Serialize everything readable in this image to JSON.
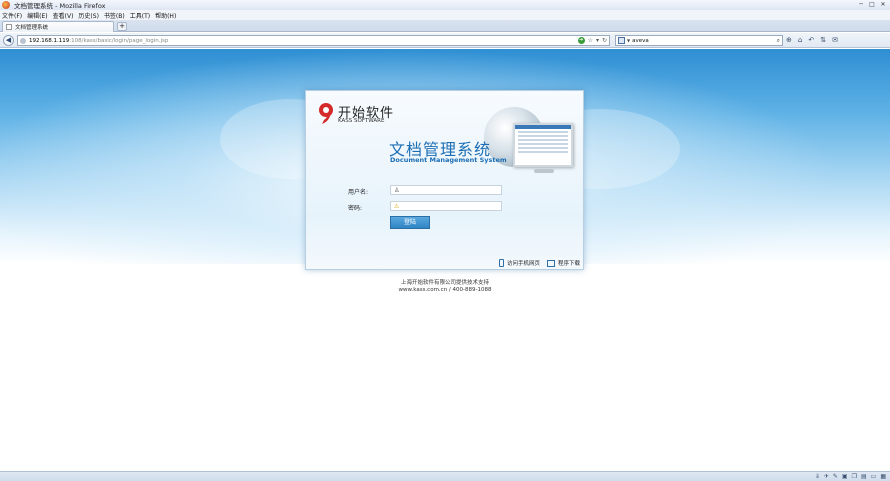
{
  "window": {
    "title": "文档管理系统 - Mozilla Firefox"
  },
  "menu": [
    "文件(F)",
    "编辑(E)",
    "查看(V)",
    "历史(S)",
    "书签(B)",
    "工具(T)",
    "帮助(H)"
  ],
  "tab": {
    "label": "文档管理系统"
  },
  "address": {
    "host": "192.168.1.119",
    "rest": ":108/kass/basic/login/page_login.jsp"
  },
  "search": {
    "value": "aveva"
  },
  "brand": {
    "cn": "开始软件",
    "en": "KASS SOFTWARE"
  },
  "system": {
    "title_cn": "文档管理系统",
    "title_en": "Document Management System"
  },
  "form": {
    "username_label": "用户名:",
    "password_label": "密码:",
    "username_value": "",
    "password_value": "",
    "login_button": "登陆"
  },
  "card_footer": {
    "mobile_link": "访问手机网页",
    "download_link": "程序下载"
  },
  "footer": {
    "line1": "上海开始软件有限公司提供技术支持",
    "line2": "www.kass.com.cn / 400-889-1088"
  },
  "colors": {
    "accent": "#1b6eb4",
    "button": "#2f84c4"
  }
}
